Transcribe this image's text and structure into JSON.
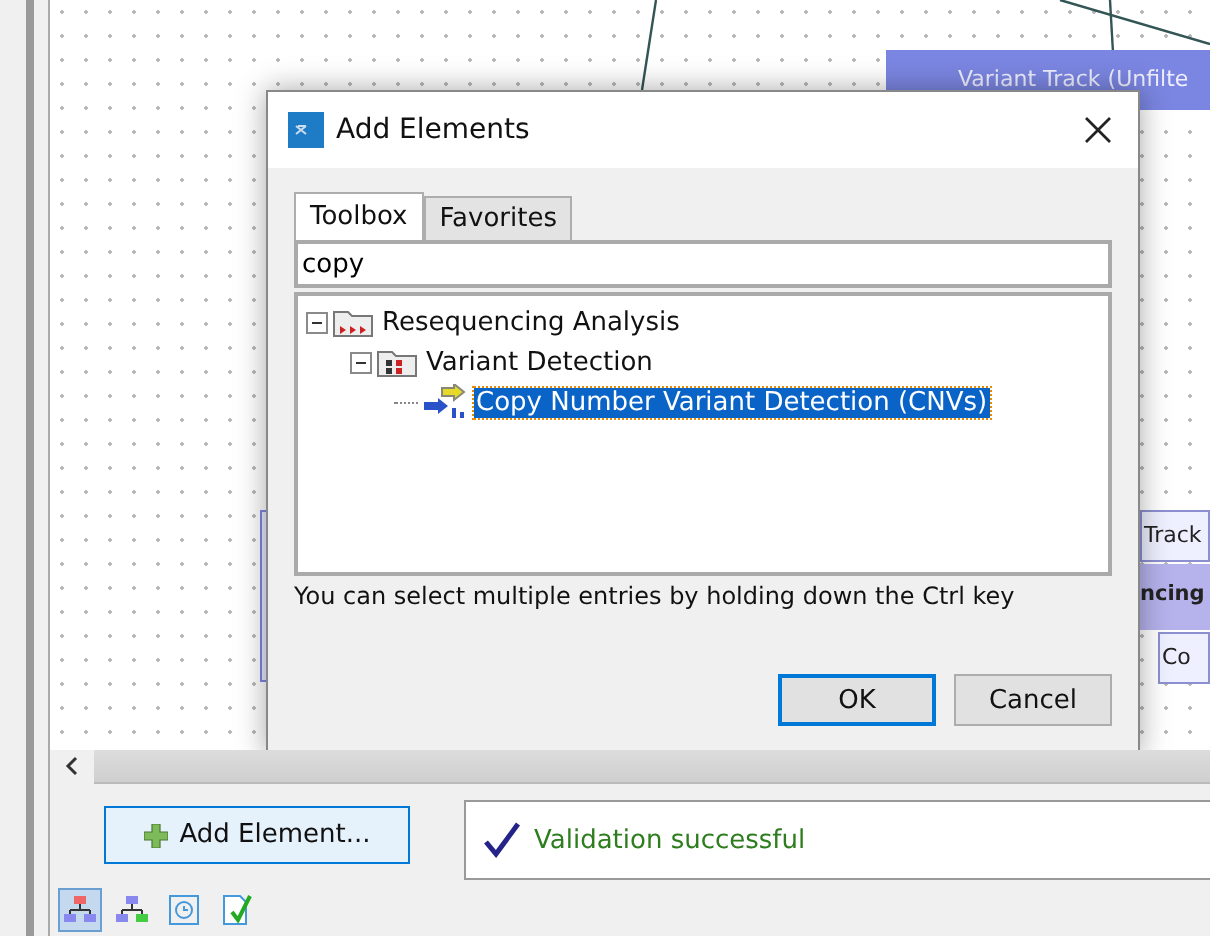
{
  "canvas": {
    "nodes": [
      {
        "kind": "header",
        "label": "Variant Track (Unfilte"
      },
      {
        "kind": "port",
        "label": "Track"
      },
      {
        "kind": "title",
        "label": "ncing"
      },
      {
        "kind": "port",
        "label": "Co"
      }
    ]
  },
  "dialog": {
    "title": "Add Elements",
    "tabs": [
      {
        "label": "Toolbox",
        "selected": true
      },
      {
        "label": "Favorites",
        "selected": false
      }
    ],
    "search": {
      "value": "copy"
    },
    "tree": [
      {
        "label": "Resequencing Analysis",
        "expanded": true,
        "selected": false,
        "children": [
          {
            "label": "Variant Detection",
            "expanded": true,
            "selected": false,
            "children": [
              {
                "label": "Copy Number Variant Detection (CNVs)",
                "selected": true
              }
            ]
          }
        ]
      }
    ],
    "hint": "You can select multiple entries by holding down the Ctrl key",
    "buttons": [
      {
        "label": "OK",
        "default": true
      },
      {
        "label": "Cancel",
        "default": false
      }
    ]
  },
  "add_button": {
    "label": "Add Element..."
  },
  "validation": {
    "message": "Validation successful"
  },
  "view_icons": [
    {
      "selected": true
    },
    {
      "selected": false
    },
    {
      "selected": false
    },
    {
      "selected": false
    }
  ]
}
